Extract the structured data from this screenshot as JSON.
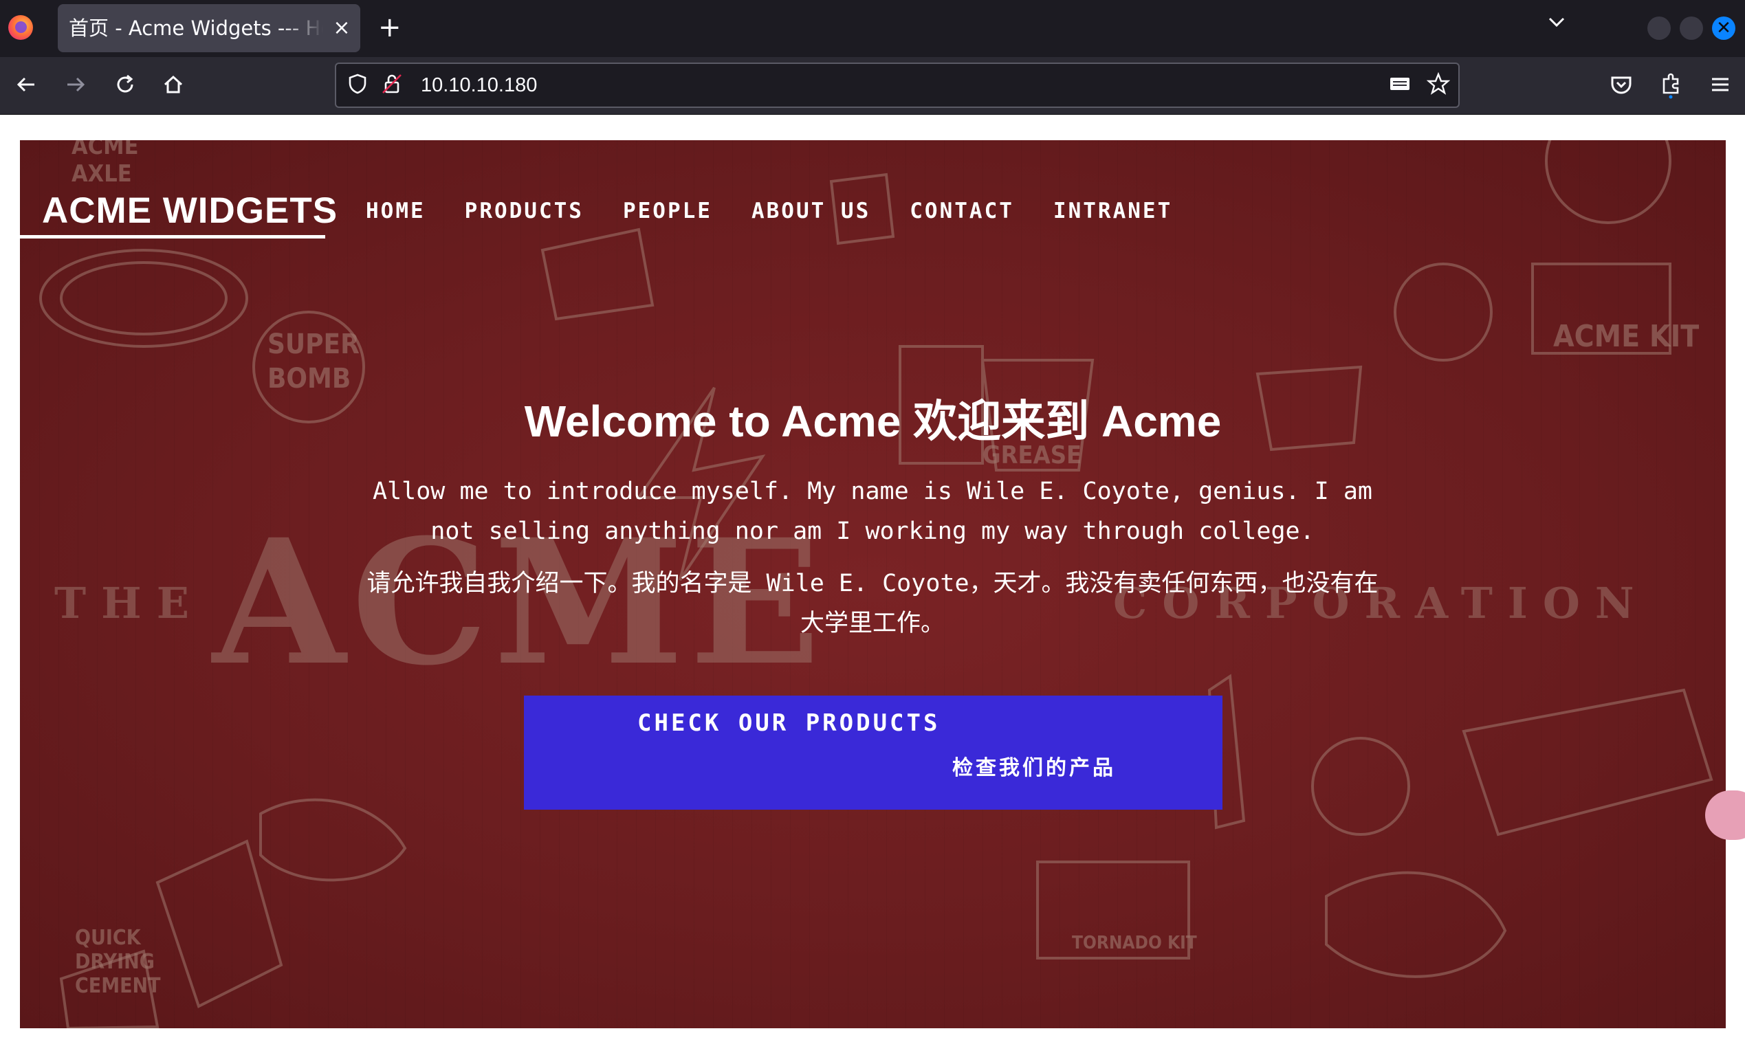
{
  "browser": {
    "tab_title": "首页 - Acme Widgets --- Home",
    "tab_close": "×",
    "new_tab": "+",
    "url": "10.10.10.180",
    "icons": [
      "firefox-logo-icon",
      "back-icon",
      "forward-icon",
      "reload-icon",
      "home-icon",
      "shield-icon",
      "lock-icon",
      "reader-icon",
      "bookmark-star-icon",
      "pocket-icon",
      "extensions-icon",
      "menu-icon",
      "chevron-down-icon",
      "window-close-icon"
    ]
  },
  "site": {
    "logo": "ACME WIDGETS",
    "nav": [
      "HOME",
      "PRODUCTS",
      "PEOPLE",
      "ABOUT US",
      "CONTACT",
      "INTRANET"
    ],
    "headline": "Welcome to Acme 欢迎来到 Acme",
    "intro_en": "Allow me to introduce myself. My name is Wile E. Coyote, genius. I am not selling anything nor am I working my way through college.",
    "intro_cn": "请允许我自我介绍一下。我的名字是 Wile E. Coyote，天才。我没有卖任何东西，也没有在大学里工作。",
    "cta_en": "CHECK OUR PRODUCTS",
    "cta_cn": "检查我们的产品",
    "background_text": [
      "THE",
      "ACME",
      "CORPORATION",
      "SUPER BOMB",
      "ACME KIT",
      "GREASE",
      "QUICK DRYING CEMENT",
      "TORNADO KIT",
      "ACME AXLE GREASE"
    ]
  },
  "colors": {
    "hero_bg": "#6a1d1f",
    "cta_bg": "#3a29d8",
    "chrome_dark": "#1c1b22",
    "chrome_toolbar": "#2b2a33",
    "accent": "#0a84ff"
  }
}
